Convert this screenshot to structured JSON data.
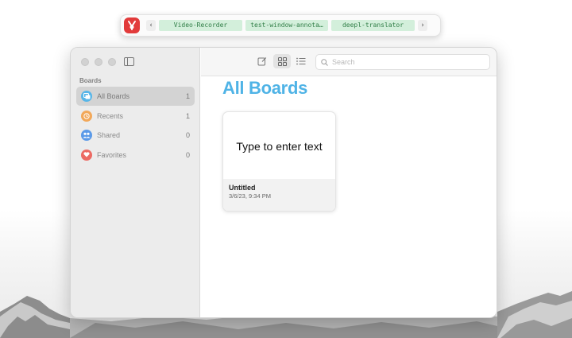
{
  "toolbar": {
    "tabs": [
      {
        "label": "Video-Recorder"
      },
      {
        "label": "test-window-annota…"
      },
      {
        "label": "deepl-translator"
      }
    ],
    "prev_label": "‹",
    "next_label": "›"
  },
  "colors": {
    "accent": "#4fb3e6",
    "tab_chip_bg": "#d3efdb",
    "tab_chip_text": "#2f7d46",
    "logo": "#e23b3b"
  },
  "window": {
    "search_placeholder": "Search",
    "sidebar": {
      "heading": "Boards",
      "items": [
        {
          "label": "All Boards",
          "count": "1",
          "icon": "boards-icon",
          "color": "#58b6e8"
        },
        {
          "label": "Recents",
          "count": "1",
          "icon": "clock-icon",
          "color": "#f2a85a"
        },
        {
          "label": "Shared",
          "count": "0",
          "icon": "people-icon",
          "color": "#5b9ae8"
        },
        {
          "label": "Favorites",
          "count": "0",
          "icon": "heart-icon",
          "color": "#ec6a63"
        }
      ]
    },
    "main": {
      "title": "All Boards",
      "cards": [
        {
          "preview_text": "Type to enter text",
          "title": "Untitled",
          "date": "3/6/23, 9:34 PM"
        }
      ]
    }
  }
}
